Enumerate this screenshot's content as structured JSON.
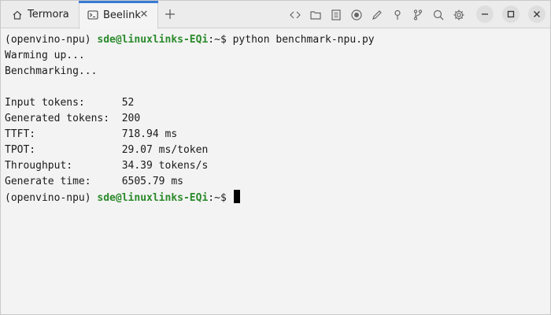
{
  "tabs": [
    {
      "label": "Termora",
      "icon": "home-icon",
      "active": false
    },
    {
      "label": "Beelink",
      "icon": "terminal-icon",
      "active": true
    }
  ],
  "toolbar_icons": [
    "code-icon",
    "folder-icon",
    "document-icon",
    "record-icon",
    "pen-icon",
    "pin-icon",
    "branch-icon",
    "search-icon",
    "gear-icon"
  ],
  "window_controls": [
    "minimize-icon",
    "maximize-icon",
    "close-icon"
  ],
  "terminal": {
    "prompt": {
      "env": "(openvino-npu) ",
      "user_host": "sde@linuxlinks-EQi",
      "path": ":~$ "
    },
    "command": "python benchmark-npu.py",
    "lines": [
      "Warming up...",
      "Benchmarking...",
      "",
      "Input tokens:      52",
      "Generated tokens:  200",
      "TTFT:              718.94 ms",
      "TPOT:              29.07 ms/token",
      "Throughput:        34.39 tokens/s",
      "Generate time:     6505.79 ms"
    ]
  },
  "colors": {
    "accent": "#3a7bd5",
    "prompt_user": "#2a8a2a",
    "background": "#f3f3f3"
  }
}
